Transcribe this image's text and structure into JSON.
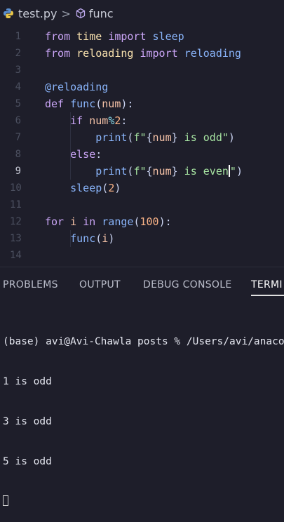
{
  "breadcrumb": {
    "file": "test.py",
    "separator": ">",
    "symbol": "func"
  },
  "editor": {
    "active_line": 9,
    "lines": [
      {
        "num": "1",
        "tokens": [
          {
            "t": "from",
            "c": "kw"
          },
          {
            "t": " "
          },
          {
            "t": "time",
            "c": "mod"
          },
          {
            "t": " "
          },
          {
            "t": "import",
            "c": "kw"
          },
          {
            "t": " "
          },
          {
            "t": "sleep",
            "c": "fn"
          }
        ]
      },
      {
        "num": "2",
        "tokens": [
          {
            "t": "from",
            "c": "kw"
          },
          {
            "t": " "
          },
          {
            "t": "reloading",
            "c": "mod"
          },
          {
            "t": " "
          },
          {
            "t": "import",
            "c": "kw"
          },
          {
            "t": " "
          },
          {
            "t": "reloading",
            "c": "fn"
          }
        ]
      },
      {
        "num": "3",
        "tokens": []
      },
      {
        "num": "4",
        "tokens": [
          {
            "t": "@reloading",
            "c": "dec"
          }
        ]
      },
      {
        "num": "5",
        "tokens": [
          {
            "t": "def",
            "c": "kw"
          },
          {
            "t": " "
          },
          {
            "t": "func",
            "c": "fn"
          },
          {
            "t": "(",
            "c": "plain"
          },
          {
            "t": "num",
            "c": "par"
          },
          {
            "t": "):",
            "c": "plain"
          }
        ]
      },
      {
        "num": "6",
        "tokens": [
          {
            "t": "    "
          },
          {
            "t": "if",
            "c": "kw"
          },
          {
            "t": " "
          },
          {
            "t": "num",
            "c": "par"
          },
          {
            "t": "%",
            "c": "op"
          },
          {
            "t": "2",
            "c": "num"
          },
          {
            "t": ":",
            "c": "plain"
          }
        ]
      },
      {
        "num": "7",
        "tokens": [
          {
            "t": "        "
          },
          {
            "t": "print",
            "c": "fn"
          },
          {
            "t": "(",
            "c": "plain"
          },
          {
            "t": "f\"",
            "c": "str"
          },
          {
            "t": "{",
            "c": "plain"
          },
          {
            "t": "num",
            "c": "par"
          },
          {
            "t": "}",
            "c": "plain"
          },
          {
            "t": " is odd\"",
            "c": "str"
          },
          {
            "t": ")",
            "c": "plain"
          }
        ]
      },
      {
        "num": "8",
        "tokens": [
          {
            "t": "    "
          },
          {
            "t": "else",
            "c": "kw"
          },
          {
            "t": ":",
            "c": "plain"
          }
        ]
      },
      {
        "num": "9",
        "tokens": [
          {
            "t": "        "
          },
          {
            "t": "print",
            "c": "fn"
          },
          {
            "t": "(",
            "c": "plain"
          },
          {
            "t": "f\"",
            "c": "str"
          },
          {
            "t": "{",
            "c": "plain"
          },
          {
            "t": "num",
            "c": "par"
          },
          {
            "t": "}",
            "c": "plain"
          },
          {
            "t": " is even",
            "c": "str"
          },
          {
            "t": "|",
            "c": "cursor"
          },
          {
            "t": "\"",
            "c": "str"
          },
          {
            "t": ")",
            "c": "plain"
          }
        ]
      },
      {
        "num": "10",
        "tokens": [
          {
            "t": "    "
          },
          {
            "t": "sleep",
            "c": "fn"
          },
          {
            "t": "(",
            "c": "plain"
          },
          {
            "t": "2",
            "c": "num"
          },
          {
            "t": ")",
            "c": "plain"
          }
        ]
      },
      {
        "num": "11",
        "tokens": []
      },
      {
        "num": "12",
        "tokens": [
          {
            "t": "for",
            "c": "kw"
          },
          {
            "t": " "
          },
          {
            "t": "i",
            "c": "par"
          },
          {
            "t": " "
          },
          {
            "t": "in",
            "c": "kw"
          },
          {
            "t": " "
          },
          {
            "t": "range",
            "c": "fn"
          },
          {
            "t": "(",
            "c": "plain"
          },
          {
            "t": "100",
            "c": "num"
          },
          {
            "t": "):",
            "c": "plain"
          }
        ]
      },
      {
        "num": "13",
        "tokens": [
          {
            "t": "    "
          },
          {
            "t": "func",
            "c": "fn"
          },
          {
            "t": "(",
            "c": "plain"
          },
          {
            "t": "i",
            "c": "par"
          },
          {
            "t": ")",
            "c": "plain"
          }
        ]
      },
      {
        "num": "14",
        "tokens": []
      }
    ]
  },
  "panel": {
    "tabs": [
      {
        "label": "PROBLEMS",
        "active": false
      },
      {
        "label": "OUTPUT",
        "active": false
      },
      {
        "label": "DEBUG CONSOLE",
        "active": false
      },
      {
        "label": "TERMI",
        "active": true
      }
    ]
  },
  "terminal": {
    "prompt": "(base) avi@Avi-Chawla posts % /Users/avi/anaco",
    "output": [
      "1 is odd",
      "3 is odd",
      "5 is odd"
    ]
  }
}
